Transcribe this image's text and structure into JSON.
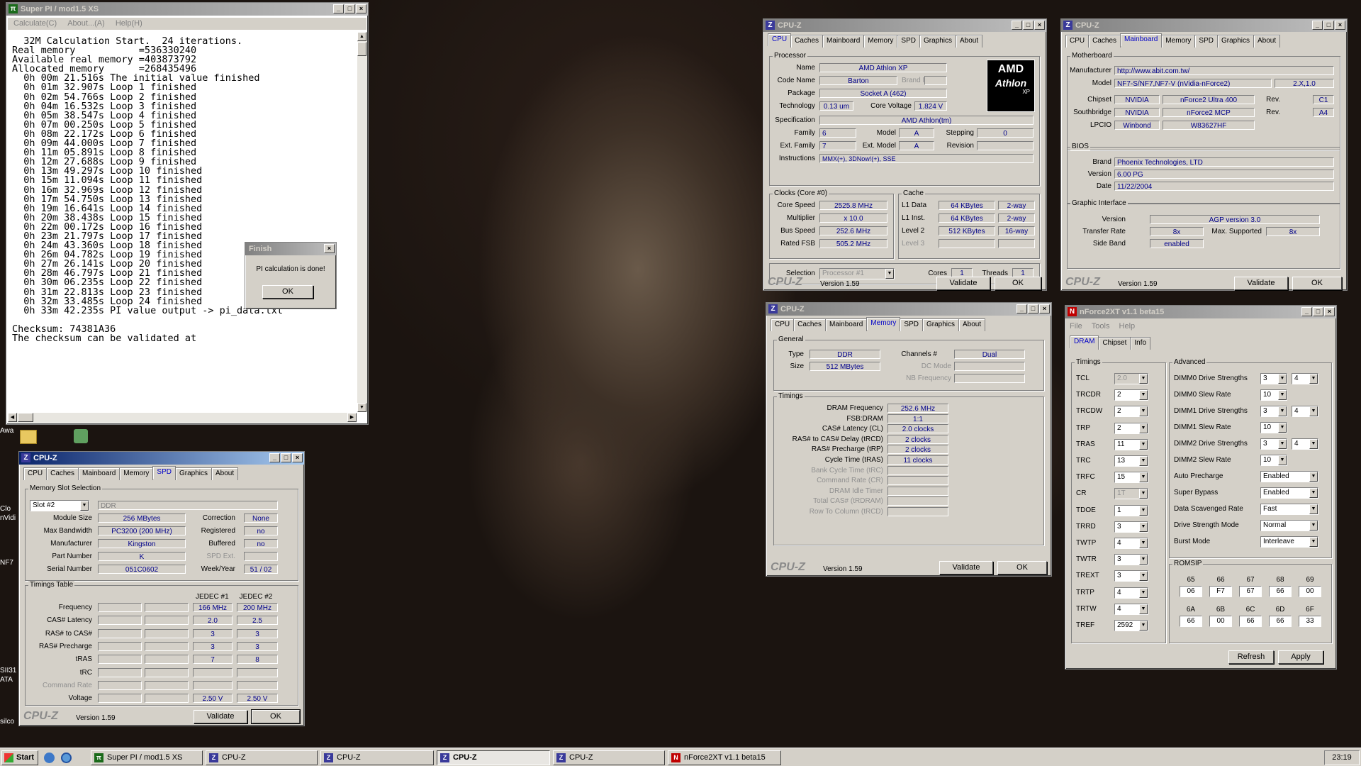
{
  "desktop": {
    "icon_labels": [
      "Awa",
      "Clo",
      "nVidi",
      "NF7",
      "SII31",
      "ATA",
      "silco"
    ]
  },
  "superpi": {
    "title": "Super PI / mod1.5 XS",
    "menu": [
      "Calculate(C)",
      "About...(A)",
      "Help(H)"
    ],
    "lines": [
      "  32M Calculation Start.  24 iterations.",
      "Real memory           =536330240",
      "Available real memory =403873792",
      "Allocated memory      =268435496",
      "  0h 00m 21.516s The initial value finished",
      "  0h 01m 32.907s Loop 1 finished",
      "  0h 02m 54.766s Loop 2 finished",
      "  0h 04m 16.532s Loop 3 finished",
      "  0h 05m 38.547s Loop 4 finished",
      "  0h 07m 00.250s Loop 5 finished",
      "  0h 08m 22.172s Loop 6 finished",
      "  0h 09m 44.000s Loop 7 finished",
      "  0h 11m 05.891s Loop 8 finished",
      "  0h 12m 27.688s Loop 9 finished",
      "  0h 13m 49.297s Loop 10 finished",
      "  0h 15m 11.094s Loop 11 finished",
      "  0h 16m 32.969s Loop 12 finished",
      "  0h 17m 54.750s Loop 13 finished",
      "  0h 19m 16.641s Loop 14 finished",
      "  0h 20m 38.438s Loop 15 finished",
      "  0h 22m 00.172s Loop 16 finished",
      "  0h 23m 21.797s Loop 17 finished",
      "  0h 24m 43.360s Loop 18 finished",
      "  0h 26m 04.782s Loop 19 finished",
      "  0h 27m 26.141s Loop 20 finished",
      "  0h 28m 46.797s Loop 21 finished",
      "  0h 30m 06.235s Loop 22 finished",
      "  0h 31m 22.813s Loop 23 finished",
      "  0h 32m 33.485s Loop 24 finished",
      "  0h 33m 42.235s PI value output -> pi_data.txt",
      "",
      "Checksum: 74381A36",
      "The checksum can be validated at"
    ]
  },
  "finish": {
    "title": "Finish",
    "message": "PI calculation is done!",
    "ok": "OK"
  },
  "cpuz_common": {
    "brand": "CPU-Z",
    "version": "Version 1.59",
    "validate": "Validate",
    "ok": "OK",
    "tabs": [
      "CPU",
      "Caches",
      "Mainboard",
      "Memory",
      "SPD",
      "Graphics",
      "About"
    ]
  },
  "cpu": {
    "title": "CPU-Z",
    "processor_legend": "Processor",
    "name_lbl": "Name",
    "name": "AMD Athlon XP",
    "codename_lbl": "Code Name",
    "codename": "Barton",
    "brandid_lbl": "Brand ID",
    "package_lbl": "Package",
    "package": "Socket A (462)",
    "tech_lbl": "Technology",
    "tech": "0.13 um",
    "corev_lbl": "Core Voltage",
    "corev": "1.824 V",
    "spec_lbl": "Specification",
    "spec": "AMD Athlon(tm)",
    "family_lbl": "Family",
    "family": "6",
    "model_lbl": "Model",
    "model": "A",
    "stepping_lbl": "Stepping",
    "stepping": "0",
    "extfam_lbl": "Ext. Family",
    "extfam": "7",
    "extmodel_lbl": "Ext. Model",
    "extmodel": "A",
    "revision_lbl": "Revision",
    "instr_lbl": "Instructions",
    "instr": "MMX(+), 3DNow!(+), SSE",
    "logo_top": "AMD",
    "logo_mid": "Athlon",
    "logo_bot": "XP",
    "clocks_legend": "Clocks (Core #0)",
    "corespeed_lbl": "Core Speed",
    "corespeed": "2525.8 MHz",
    "mult_lbl": "Multiplier",
    "mult": "x 10.0",
    "bus_lbl": "Bus Speed",
    "bus": "252.6 MHz",
    "fsb_lbl": "Rated FSB",
    "fsb": "505.2 MHz",
    "cache_legend": "Cache",
    "l1d_lbl": "L1 Data",
    "l1d": "64 KBytes",
    "l1d_way": "2-way",
    "l1i_lbl": "L1 Inst.",
    "l1i": "64 KBytes",
    "l1i_way": "2-way",
    "l2_lbl": "Level 2",
    "l2": "512 KBytes",
    "l2_way": "16-way",
    "l3_lbl": "Level 3",
    "selection_lbl": "Selection",
    "selection": "Processor #1",
    "cores_lbl": "Cores",
    "cores": "1",
    "threads_lbl": "Threads",
    "threads": "1"
  },
  "mb": {
    "title": "CPU-Z",
    "mb_legend": "Motherboard",
    "manu_lbl": "Manufacturer",
    "manu": "http://www.abit.com.tw/",
    "model_lbl": "Model",
    "model": "NF7-S/NF7,NF7-V (nVidia-nForce2)",
    "model_rev": "2.X,1.0",
    "chipset_lbl": "Chipset",
    "chipset_v": "NVIDIA",
    "chipset": "nForce2 Ultra 400",
    "rev_lbl": "Rev.",
    "chipset_rev": "C1",
    "sb_lbl": "Southbridge",
    "sb_v": "NVIDIA",
    "sb": "nForce2 MCP",
    "sb_rev": "A4",
    "lpcio_lbl": "LPCIO",
    "lpcio_v": "Winbond",
    "lpcio": "W83627HF",
    "bios_legend": "BIOS",
    "brand_lbl": "Brand",
    "brand": "Phoenix Technologies, LTD",
    "version_lbl": "Version",
    "version": "6.00 PG",
    "date_lbl": "Date",
    "date": "11/22/2004",
    "gi_legend": "Graphic Interface",
    "gver_lbl": "Version",
    "gver": "AGP version 3.0",
    "rate_lbl": "Transfer Rate",
    "rate": "8x",
    "maxsup_lbl": "Max. Supported",
    "maxsup": "8x",
    "side_lbl": "Side Band",
    "side": "enabled"
  },
  "mem": {
    "title": "CPU-Z",
    "gen_legend": "General",
    "type_lbl": "Type",
    "type": "DDR",
    "ch_lbl": "Channels #",
    "ch": "Dual",
    "size_lbl": "Size",
    "size": "512 MBytes",
    "dc_lbl": "DC Mode",
    "nb_lbl": "NB Frequency",
    "tim_legend": "Timings",
    "rows": [
      [
        "DRAM Frequency",
        "252.6 MHz",
        false
      ],
      [
        "FSB:DRAM",
        "1:1",
        false
      ],
      [
        "CAS# Latency (CL)",
        "2.0 clocks",
        false
      ],
      [
        "RAS# to CAS# Delay (tRCD)",
        "2 clocks",
        false
      ],
      [
        "RAS# Precharge (tRP)",
        "2 clocks",
        false
      ],
      [
        "Cycle Time (tRAS)",
        "11 clocks",
        false
      ],
      [
        "Bank Cycle Time (tRC)",
        "",
        true
      ],
      [
        "Command Rate (CR)",
        "",
        true
      ],
      [
        "DRAM Idle Timer",
        "",
        true
      ],
      [
        "Total CAS# (tRDRAM)",
        "",
        true
      ],
      [
        "Row To Column (tRCD)",
        "",
        true
      ]
    ]
  },
  "spd": {
    "title": "CPU-Z",
    "slot_legend": "Memory Slot Selection",
    "slot": "Slot #2",
    "slot_type": "DDR",
    "modsize_lbl": "Module Size",
    "modsize": "256 MBytes",
    "corr_lbl": "Correction",
    "corr": "None",
    "maxbw_lbl": "Max Bandwidth",
    "maxbw": "PC3200 (200 MHz)",
    "reg_lbl": "Registered",
    "reg": "no",
    "manu_lbl": "Manufacturer",
    "manu": "Kingston",
    "buf_lbl": "Buffered",
    "buf": "no",
    "part_lbl": "Part Number",
    "part": "K",
    "spdext_lbl": "SPD Ext.",
    "serial_lbl": "Serial Number",
    "serial": "051C0602",
    "week_lbl": "Week/Year",
    "week": "51 / 02",
    "tt_legend": "Timings Table",
    "j1": "JEDEC #1",
    "j2": "JEDEC #2",
    "rows": [
      [
        "Frequency",
        "166 MHz",
        "200 MHz",
        false
      ],
      [
        "CAS# Latency",
        "2.0",
        "2.5",
        false
      ],
      [
        "RAS# to CAS#",
        "3",
        "3",
        false
      ],
      [
        "RAS# Precharge",
        "3",
        "3",
        false
      ],
      [
        "tRAS",
        "7",
        "8",
        false
      ],
      [
        "tRC",
        "",
        "",
        false
      ],
      [
        "Command Rate",
        "",
        "",
        true
      ],
      [
        "Voltage",
        "2.50 V",
        "2.50 V",
        false
      ]
    ]
  },
  "nf": {
    "title": "nForce2XT v1.1 beta15",
    "menu": [
      "File",
      "Tools",
      "Help"
    ],
    "tabs": [
      "DRAM",
      "Chipset",
      "Info"
    ],
    "tim_legend": "Timings",
    "adv_legend": "Advanced",
    "romsip_legend": "ROMSIP",
    "timings": [
      [
        "TCL",
        "2.0",
        true
      ],
      [
        "TRCDR",
        "2",
        false
      ],
      [
        "TRCDW",
        "2",
        false
      ],
      [
        "TRP",
        "2",
        false
      ],
      [
        "TRAS",
        "11",
        false
      ],
      [
        "TRC",
        "13",
        false
      ],
      [
        "TRFC",
        "15",
        false
      ],
      [
        "CR",
        "1T",
        true
      ],
      [
        "TDOE",
        "1",
        false
      ],
      [
        "TRRD",
        "3",
        false
      ],
      [
        "TWTP",
        "4",
        false
      ],
      [
        "TWTR",
        "3",
        false
      ],
      [
        "TREXT",
        "3",
        false
      ],
      [
        "TRTP",
        "4",
        false
      ],
      [
        "TRTW",
        "4",
        false
      ],
      [
        "TREF",
        "2592",
        false
      ]
    ],
    "adv": [
      [
        "DIMM0 Drive Strengths",
        "3",
        "4"
      ],
      [
        "DIMM0 Slew Rate",
        "10",
        ""
      ],
      [
        "DIMM1 Drive Strengths",
        "3",
        "4"
      ],
      [
        "DIMM1 Slew Rate",
        "10",
        ""
      ],
      [
        "DIMM2 Drive Strengths",
        "3",
        "4"
      ],
      [
        "DIMM2 Slew Rate",
        "10",
        ""
      ],
      [
        "Auto Precharge",
        "Enabled",
        ""
      ],
      [
        "Super Bypass",
        "Enabled",
        ""
      ],
      [
        "Data Scavenged Rate",
        "Fast",
        ""
      ],
      [
        "Drive Strength Mode",
        "Normal",
        ""
      ],
      [
        "Burst Mode",
        "Interleave",
        ""
      ]
    ],
    "romsip_h1": [
      "65",
      "66",
      "67",
      "68",
      "69"
    ],
    "romsip_v1": [
      "06",
      "F7",
      "67",
      "66",
      "00"
    ],
    "romsip_h2": [
      "6A",
      "6B",
      "6C",
      "6D",
      "6F"
    ],
    "romsip_v2": [
      "66",
      "00",
      "66",
      "66",
      "33"
    ],
    "refresh": "Refresh",
    "apply": "Apply"
  },
  "taskbar": {
    "start": "Start",
    "tasks": [
      "Super PI / mod1.5 XS",
      "CPU-Z",
      "CPU-Z",
      "CPU-Z",
      "CPU-Z",
      "nForce2XT v1.1 beta15"
    ],
    "clock": "23:19"
  }
}
